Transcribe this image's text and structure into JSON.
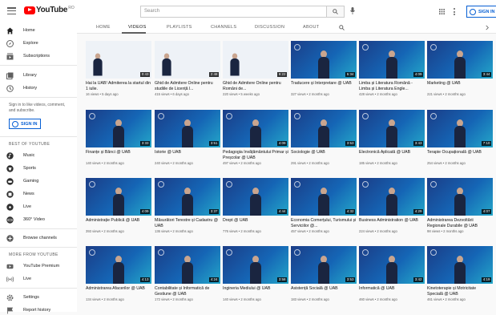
{
  "header": {
    "logo_text": "YouTube",
    "logo_sup": "RO",
    "search_placeholder": "Search",
    "signin_label": "SIGN IN"
  },
  "sidebar": {
    "items": [
      {
        "label": "Home",
        "icon": "home-icon"
      },
      {
        "label": "Explore",
        "icon": "explore-icon"
      },
      {
        "label": "Subscriptions",
        "icon": "subscriptions-icon"
      },
      {
        "label": "Library",
        "icon": "library-icon"
      },
      {
        "label": "History",
        "icon": "history-icon"
      }
    ],
    "signin_prompt": "Sign in to like videos, comment, and subscribe.",
    "signin_label": "SIGN IN",
    "best_heading": "BEST OF YOUTUBE",
    "best_items": [
      {
        "label": "Music",
        "icon": "music-icon"
      },
      {
        "label": "Sports",
        "icon": "sports-icon"
      },
      {
        "label": "Gaming",
        "icon": "gaming-icon"
      },
      {
        "label": "News",
        "icon": "news-icon"
      },
      {
        "label": "Live",
        "icon": "live-icon"
      },
      {
        "label": "360° Video",
        "icon": "360-icon"
      }
    ],
    "browse_label": "Browse channels",
    "more_heading": "MORE FROM YOUTUBE",
    "more_items": [
      {
        "label": "YouTube Premium",
        "icon": "premium-icon"
      },
      {
        "label": "Live",
        "icon": "live-wave-icon"
      }
    ],
    "settings_label": "Settings",
    "report_label": "Report history"
  },
  "tabs": [
    "HOME",
    "VIDEOS",
    "PLAYLISTS",
    "CHANNELS",
    "DISCUSSION",
    "ABOUT"
  ],
  "active_tab": "VIDEOS",
  "videos": [
    {
      "title": "Hai la UAB! Admiterea la startul din 1 iulie.",
      "meta": "16 views • 5 days ago",
      "dur": "0:43",
      "style": "white"
    },
    {
      "title": "Ghid de Admitere Online pentru studiile de Licență l...",
      "meta": "415 views • 6 days ago",
      "dur": "2:48",
      "style": "white"
    },
    {
      "title": "Ghid de Admitere Online pentru Români de...",
      "meta": "220 views • 5 weeks ago",
      "dur": "9:22",
      "style": "white"
    },
    {
      "title": "Traducere și Interpretare @ UAB",
      "meta": "327 views • 2 months ago",
      "dur": "5:34",
      "style": "blue"
    },
    {
      "title": "Limba și Literatura Română - Limba și Literatura Engle...",
      "meta": "428 views • 2 months ago",
      "dur": "4:09",
      "style": "blue"
    },
    {
      "title": "Marketing @ UAB",
      "meta": "221 views • 2 months ago",
      "dur": "3:44",
      "style": "blue"
    },
    {
      "title": "Finanțe și Bănci @ UAB",
      "meta": "140 views • 2 months ago",
      "dur": "3:33",
      "style": "blue"
    },
    {
      "title": "Istorie @ UAB",
      "meta": "240 views • 2 months ago",
      "dur": "3:51",
      "style": "blue"
    },
    {
      "title": "Pedagogia Învățământului Primar și Preșcolar @ UAB",
      "meta": "497 views • 2 months ago",
      "dur": "4:09",
      "style": "blue"
    },
    {
      "title": "Sociologie @ UAB",
      "meta": "291 views • 2 months ago",
      "dur": "3:53",
      "style": "blue"
    },
    {
      "title": "Electronică Aplicată @ UAB",
      "meta": "185 views • 2 months ago",
      "dur": "3:43",
      "style": "blue"
    },
    {
      "title": "Terapie Ocupațională @ UAB",
      "meta": "254 views • 2 months ago",
      "dur": "7:10",
      "style": "blue"
    },
    {
      "title": "Administrație Publică @ UAB",
      "meta": "393 views • 2 months ago",
      "dur": "4:09",
      "style": "blue"
    },
    {
      "title": "Măsurători Terestre și Cadastru @ UAB",
      "meta": "136 views • 2 months ago",
      "dur": "3:37",
      "style": "blue"
    },
    {
      "title": "Drept @ UAB",
      "meta": "776 views • 2 months ago",
      "dur": "4:44",
      "style": "blue"
    },
    {
      "title": "Economia Comerțului, Turismului și Serviciilor @...",
      "meta": "457 views • 2 months ago",
      "dur": "4:32",
      "style": "blue"
    },
    {
      "title": "Business Administration @ UAB",
      "meta": "224 views • 2 months ago",
      "dur": "4:29",
      "style": "blue"
    },
    {
      "title": "Administrarea Dezvoltării Regionale Durabile @ UAB",
      "meta": "98 views • 2 months ago",
      "dur": "4:07",
      "style": "blue"
    },
    {
      "title": "Administrarea Afacerilor @ UAB",
      "meta": "134 views • 2 months ago",
      "dur": "4:13",
      "style": "blue"
    },
    {
      "title": "Contabilitate și Informatică de Gestiune @ UAB",
      "meta": "172 views • 2 months ago",
      "dur": "4:24",
      "style": "blue"
    },
    {
      "title": "Ingineria Mediului @ UAB",
      "meta": "140 views • 2 months ago",
      "dur": "3:58",
      "style": "blue"
    },
    {
      "title": "Asistență Socială @ UAB",
      "meta": "183 views • 2 months ago",
      "dur": "3:53",
      "style": "blue"
    },
    {
      "title": "Informatică @ UAB",
      "meta": "460 views • 2 months ago",
      "dur": "3:42",
      "style": "blue"
    },
    {
      "title": "Kinetoterapie și Motricitate Specială @ UAB",
      "meta": "461 views • 2 months ago",
      "dur": "4:19",
      "style": "blue"
    }
  ]
}
